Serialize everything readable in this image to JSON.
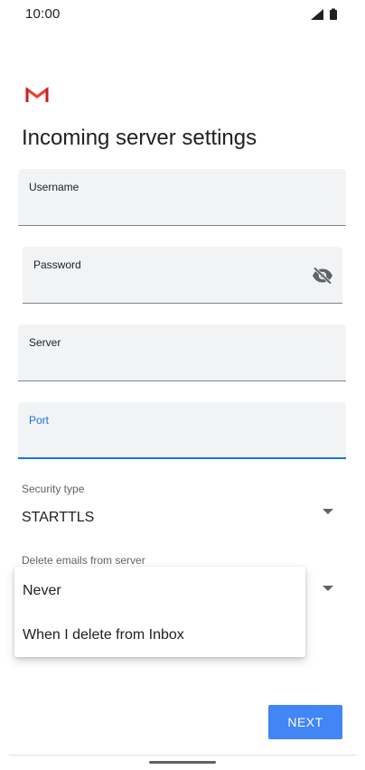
{
  "status_bar": {
    "time": "10:00",
    "icons": [
      "signal-icon",
      "battery-icon"
    ]
  },
  "header": {
    "logo_icon": "gmail-icon",
    "title": "Incoming server settings"
  },
  "form": {
    "username": {
      "label": "Username",
      "value": ""
    },
    "password": {
      "label": "Password",
      "value": "",
      "toggle_icon": "visibility-off-icon"
    },
    "server": {
      "label": "Server",
      "value": ""
    },
    "port": {
      "label": "Port",
      "value": "",
      "focused": true
    },
    "security_type": {
      "label": "Security type",
      "value": "STARTTLS"
    },
    "delete_emails": {
      "label": "Delete emails from server"
    }
  },
  "dropdown_menu": {
    "options": [
      "Never",
      "When I delete from Inbox"
    ]
  },
  "footer": {
    "next_label": "NEXT"
  },
  "colors": {
    "accent": "#1a73e8",
    "button": "#4285f4",
    "field_background": "#f1f3f4",
    "gmail_red": "#d93025"
  }
}
